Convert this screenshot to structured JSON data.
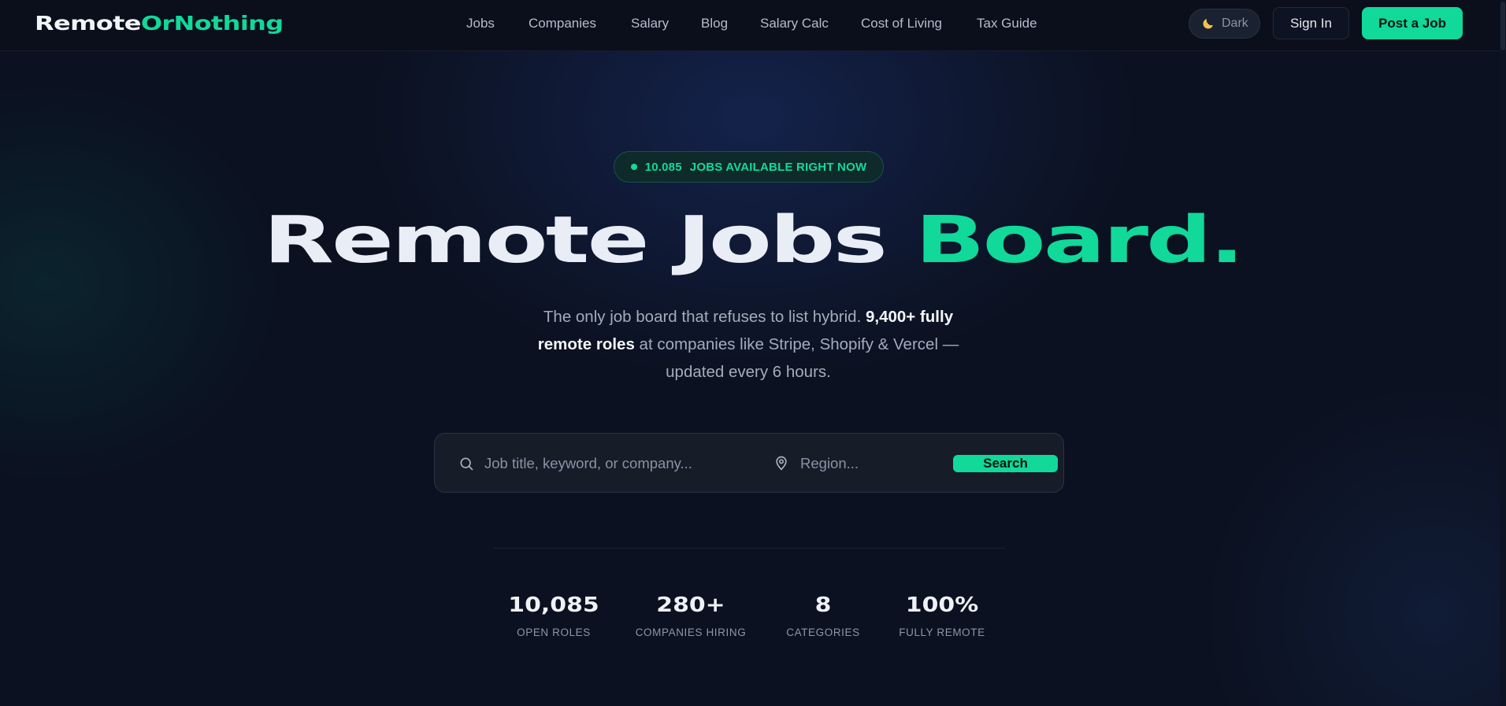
{
  "brand": {
    "part1": "Remote",
    "part2": "OrNothing"
  },
  "nav": {
    "links": [
      "Jobs",
      "Companies",
      "Salary",
      "Blog",
      "Salary Calc",
      "Cost of Living",
      "Tax Guide"
    ],
    "theme_label": "Dark",
    "sign_in": "Sign In",
    "post_job": "Post a Job"
  },
  "hero": {
    "badge_count": "10.085",
    "badge_text": "JOBS AVAILABLE RIGHT NOW",
    "title_white": "Remote Jobs ",
    "title_green": "Board.",
    "subtitle_pre": "The only job board that refuses to list hybrid. ",
    "subtitle_bold": "9,400+ fully remote roles",
    "subtitle_post": " at companies like Stripe, Shopify & Vercel — updated every 6 hours."
  },
  "search": {
    "keyword_placeholder": "Job title, keyword, or company...",
    "keyword_value": "",
    "region_placeholder": "Region...",
    "region_value": "",
    "button_label": "Search"
  },
  "stats": [
    {
      "value": "10,085",
      "label": "OPEN ROLES"
    },
    {
      "value": "280+",
      "label": "COMPANIES HIRING"
    },
    {
      "value": "8",
      "label": "CATEGORIES"
    },
    {
      "value": "100%",
      "label": "FULLY REMOTE"
    }
  ],
  "colors": {
    "accent": "#10d99a",
    "background": "#0b1120",
    "nav_bg": "#0a0f1b"
  },
  "icons": {
    "theme": "moon-icon",
    "search": "search-icon",
    "region": "map-pin-icon"
  }
}
